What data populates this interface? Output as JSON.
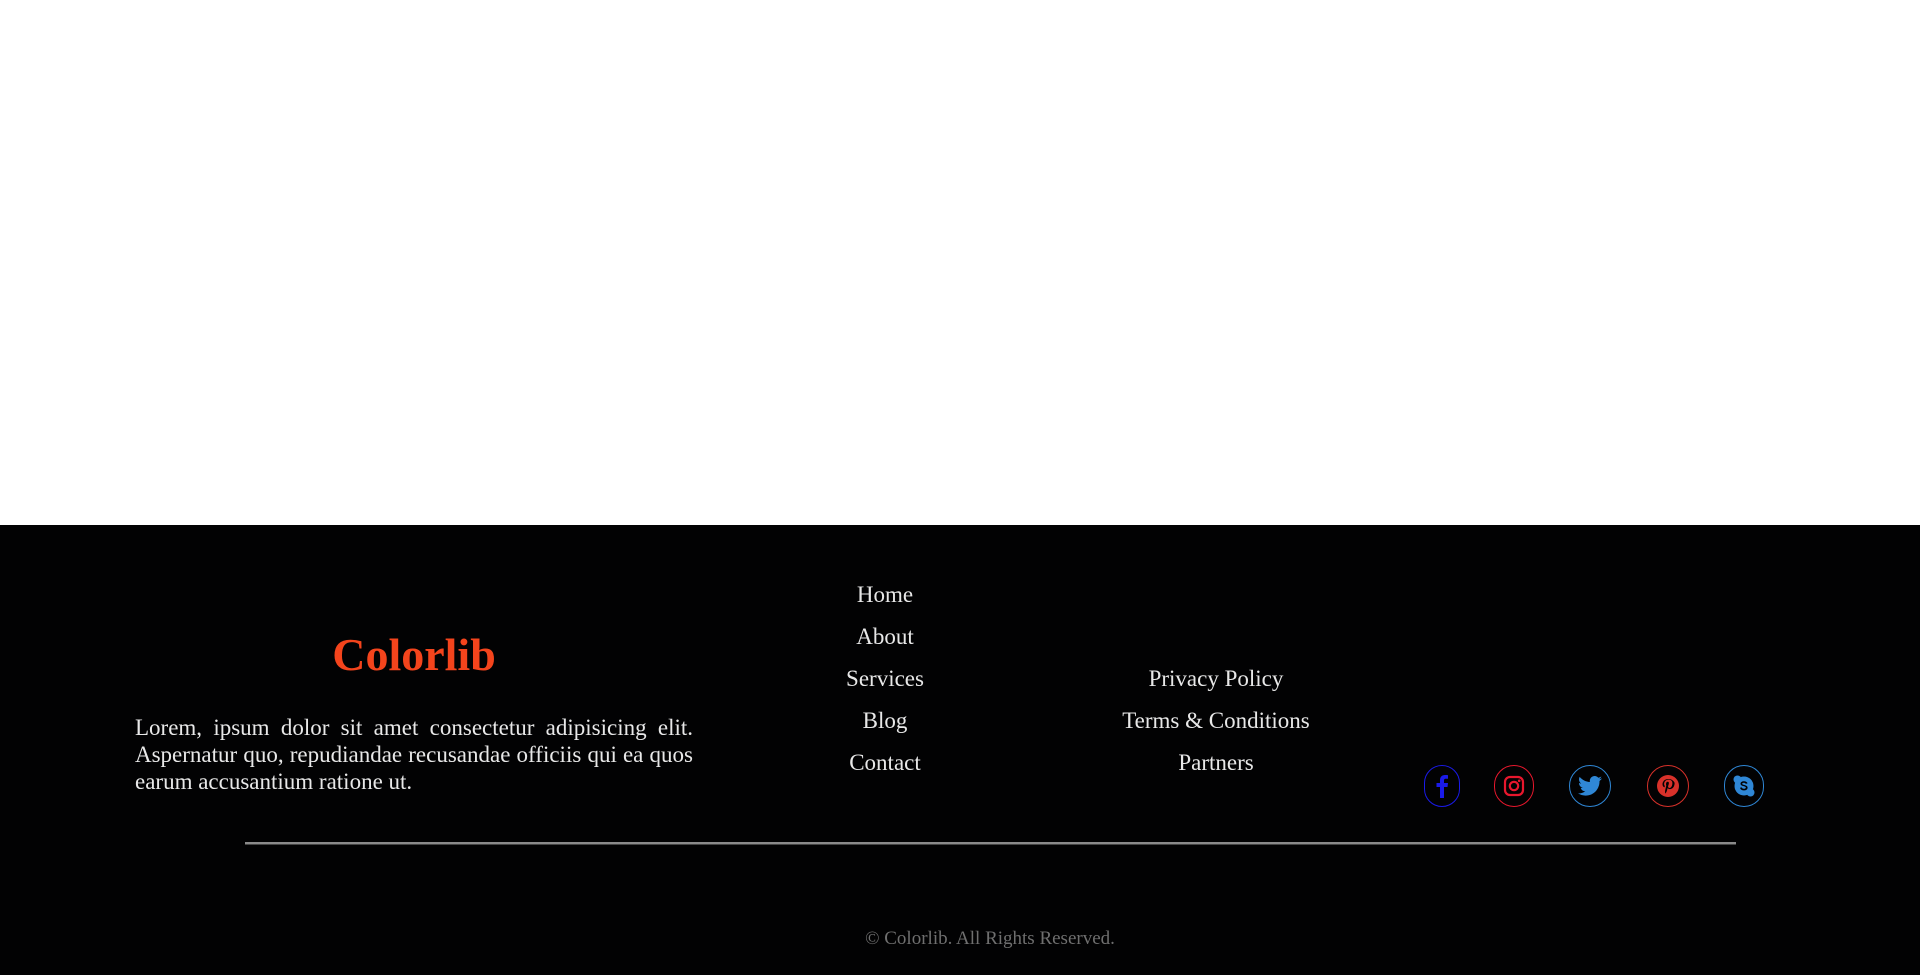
{
  "footer": {
    "brand": {
      "name": "Colorlib",
      "description": "Lorem, ipsum dolor sit amet consectetur adipisicing elit. Aspernatur quo, repudiandae recusandae officiis qui ea quos earum accusantium ratione ut."
    },
    "nav_links": [
      "Home",
      "About",
      "Services",
      "Blog",
      "Contact"
    ],
    "legal_links": [
      "Privacy Policy",
      "Terms & Conditions",
      "Partners"
    ],
    "social": [
      {
        "name": "facebook-icon",
        "color": "#1a1ae8"
      },
      {
        "name": "instagram-icon",
        "color": "#e8172d"
      },
      {
        "name": "twitter-icon",
        "color": "#2f87d6"
      },
      {
        "name": "pinterest-icon",
        "color": "#d8312a"
      },
      {
        "name": "skype-icon",
        "color": "#2f87d6"
      }
    ],
    "copyright": "© Colorlib. All Rights Reserved."
  },
  "colors": {
    "footer_background": "#020203",
    "brand_accent": "#f4441c",
    "text": "#e8e8e8",
    "muted_text": "#6f6f6f"
  }
}
